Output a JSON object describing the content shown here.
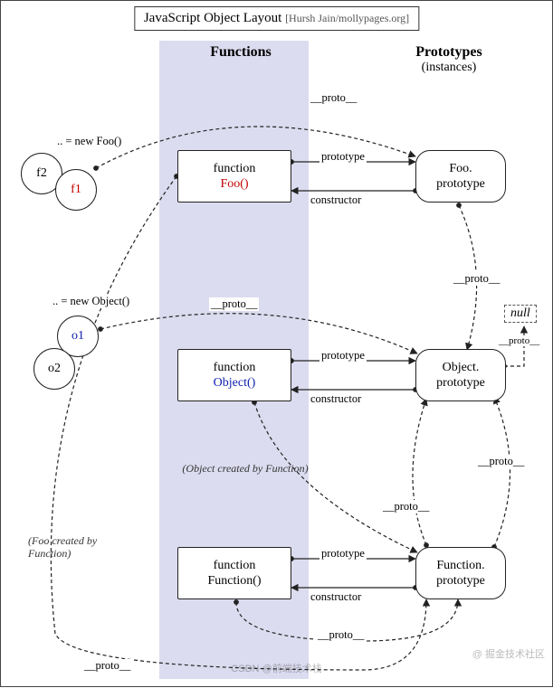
{
  "title": {
    "main": "JavaScript Object Layout",
    "sub": "[Hursh Jain/mollypages.org]"
  },
  "columns": {
    "functions": "Functions",
    "prototypes": "Prototypes",
    "prototypes_sub": "(instances)"
  },
  "nodes": {
    "foo_func": {
      "line1": "function",
      "line2": "Foo()"
    },
    "object_func": {
      "line1": "function",
      "line2": "Object()"
    },
    "function_func": {
      "line1": "function",
      "line2": "Function()"
    },
    "foo_proto": {
      "line1": "Foo.",
      "line2": "prototype"
    },
    "object_proto": {
      "line1": "Object.",
      "line2": "prototype"
    },
    "function_proto": {
      "line1": "Function.",
      "line2": "prototype"
    },
    "null": "null"
  },
  "instances": {
    "f1": "f1",
    "f2": "f2",
    "o1": "o1",
    "o2": "o2",
    "foo_new": ".. = new Foo()",
    "obj_new": ".. = new Object()"
  },
  "edge_labels": {
    "proto": "__proto__",
    "prototype": "prototype",
    "constructor": "constructor"
  },
  "notes": {
    "obj_created": "(Object created by Function)",
    "foo_created": "(Foo created by Function)"
  },
  "watermark": "@ 掘金技术社区",
  "watermark2": "CSDN @前端技术栈"
}
